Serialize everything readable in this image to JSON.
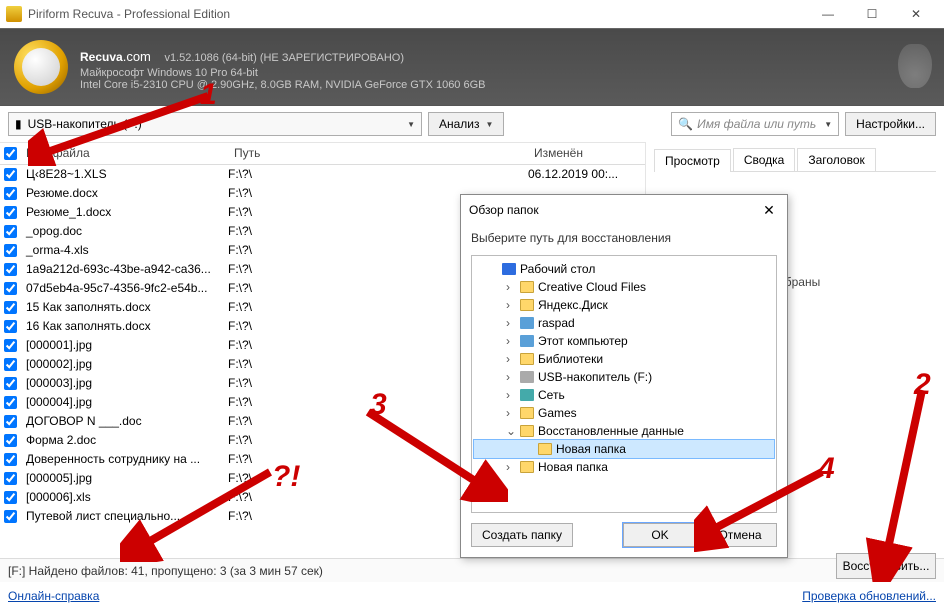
{
  "window": {
    "title": "Piriform Recuva - Professional Edition",
    "brand_html": "Recuva",
    "brand_suffix": ".com",
    "version": "v1.52.1086 (64-bit) (НЕ ЗАРЕГИСТРИРОВАНО)",
    "os_line": "Майкрософт Windows 10 Pro 64-bit",
    "hw_line": "Intel Core i5-2310 CPU @ 2.90GHz, 8.0GB RAM, NVIDIA GeForce GTX 1060 6GB"
  },
  "toolbar": {
    "drive_label": "USB-накопитель (F:)",
    "analyze": "Анализ",
    "search_placeholder": "Имя файла или путь",
    "settings": "Настройки..."
  },
  "columns": {
    "name": "Имя файла",
    "path": "Путь",
    "modified": "Изменён"
  },
  "files": [
    {
      "checked": true,
      "name": "Ц‹8E28~1.XLS",
      "path": "F:\\?\\",
      "modified": "06.12.2019 00:..."
    },
    {
      "checked": true,
      "name": "Резюме.docx",
      "path": "F:\\?\\",
      "modified": ""
    },
    {
      "checked": true,
      "name": "Резюме_1.docx",
      "path": "F:\\?\\",
      "modified": ""
    },
    {
      "checked": true,
      "name": "_opog.doc",
      "path": "F:\\?\\",
      "modified": ""
    },
    {
      "checked": true,
      "name": "_orma-4.xls",
      "path": "F:\\?\\",
      "modified": ""
    },
    {
      "checked": true,
      "name": "1a9a212d-693c-43be-a942-ca36...",
      "path": "F:\\?\\",
      "modified": ""
    },
    {
      "checked": true,
      "name": "07d5eb4a-95c7-4356-9fc2-e54b...",
      "path": "F:\\?\\",
      "modified": ""
    },
    {
      "checked": true,
      "name": "15 Как заполнять.docx",
      "path": "F:\\?\\",
      "modified": ""
    },
    {
      "checked": true,
      "name": "16 Как заполнять.docx",
      "path": "F:\\?\\",
      "modified": ""
    },
    {
      "checked": true,
      "name": "[000001].jpg",
      "path": "F:\\?\\",
      "modified": ""
    },
    {
      "checked": true,
      "name": "[000002].jpg",
      "path": "F:\\?\\",
      "modified": ""
    },
    {
      "checked": true,
      "name": "[000003].jpg",
      "path": "F:\\?\\",
      "modified": ""
    },
    {
      "checked": true,
      "name": "[000004].jpg",
      "path": "F:\\?\\",
      "modified": ""
    },
    {
      "checked": true,
      "name": "ДОГОВОР N ___.doc",
      "path": "F:\\?\\",
      "modified": ""
    },
    {
      "checked": true,
      "name": "Форма 2.doc",
      "path": "F:\\?\\",
      "modified": ""
    },
    {
      "checked": true,
      "name": "Доверенность сотруднику на ...",
      "path": "F:\\?\\",
      "modified": ""
    },
    {
      "checked": true,
      "name": "[000005].jpg",
      "path": "F:\\?\\",
      "modified": ""
    },
    {
      "checked": true,
      "name": "[000006].xls",
      "path": "F:\\?\\",
      "modified": ""
    },
    {
      "checked": true,
      "name": "Путевой лист специально...",
      "path": "F:\\?\\",
      "modified": ""
    }
  ],
  "side": {
    "tabs": [
      "Просмотр",
      "Сводка",
      "Заголовок"
    ],
    "active_tab": 0,
    "body_text": "выбраны"
  },
  "status": "[F:] Найдено файлов: 41, пропущено: 3 (за 3 мин 57 сек)",
  "bottom": {
    "help_link": "Онлайн-справка",
    "update_link": "Проверка обновлений..."
  },
  "recover_button": "Восстановить...",
  "dialog": {
    "title": "Обзор папок",
    "message": "Выберите путь для восстановления",
    "tree": [
      {
        "depth": 0,
        "icon": "blue",
        "label": "Рабочий стол",
        "expander": ""
      },
      {
        "depth": 1,
        "icon": "folder",
        "label": "Creative Cloud Files",
        "expander": "›"
      },
      {
        "depth": 1,
        "icon": "folder",
        "label": "Яндекс.Диск",
        "expander": "›"
      },
      {
        "depth": 1,
        "icon": "pc",
        "label": "raspad",
        "expander": "›"
      },
      {
        "depth": 1,
        "icon": "pc",
        "label": "Этот компьютер",
        "expander": "›"
      },
      {
        "depth": 1,
        "icon": "folder",
        "label": "Библиотеки",
        "expander": "›"
      },
      {
        "depth": 1,
        "icon": "drive",
        "label": "USB-накопитель (F:)",
        "expander": "›"
      },
      {
        "depth": 1,
        "icon": "net",
        "label": "Сеть",
        "expander": "›"
      },
      {
        "depth": 1,
        "icon": "folder",
        "label": "Games",
        "expander": "›"
      },
      {
        "depth": 1,
        "icon": "folder",
        "label": "Восстановленные данные",
        "expander": "⌄"
      },
      {
        "depth": 2,
        "icon": "folder",
        "label": "Новая папка",
        "expander": "",
        "selected": true
      },
      {
        "depth": 1,
        "icon": "folder",
        "label": "Новая папка",
        "expander": "›"
      }
    ],
    "new_folder": "Создать папку",
    "ok": "OK",
    "cancel": "Отмена"
  },
  "annotations": {
    "n1": "1",
    "n2": "2",
    "n3": "3",
    "n4": "4",
    "q": "?!"
  }
}
